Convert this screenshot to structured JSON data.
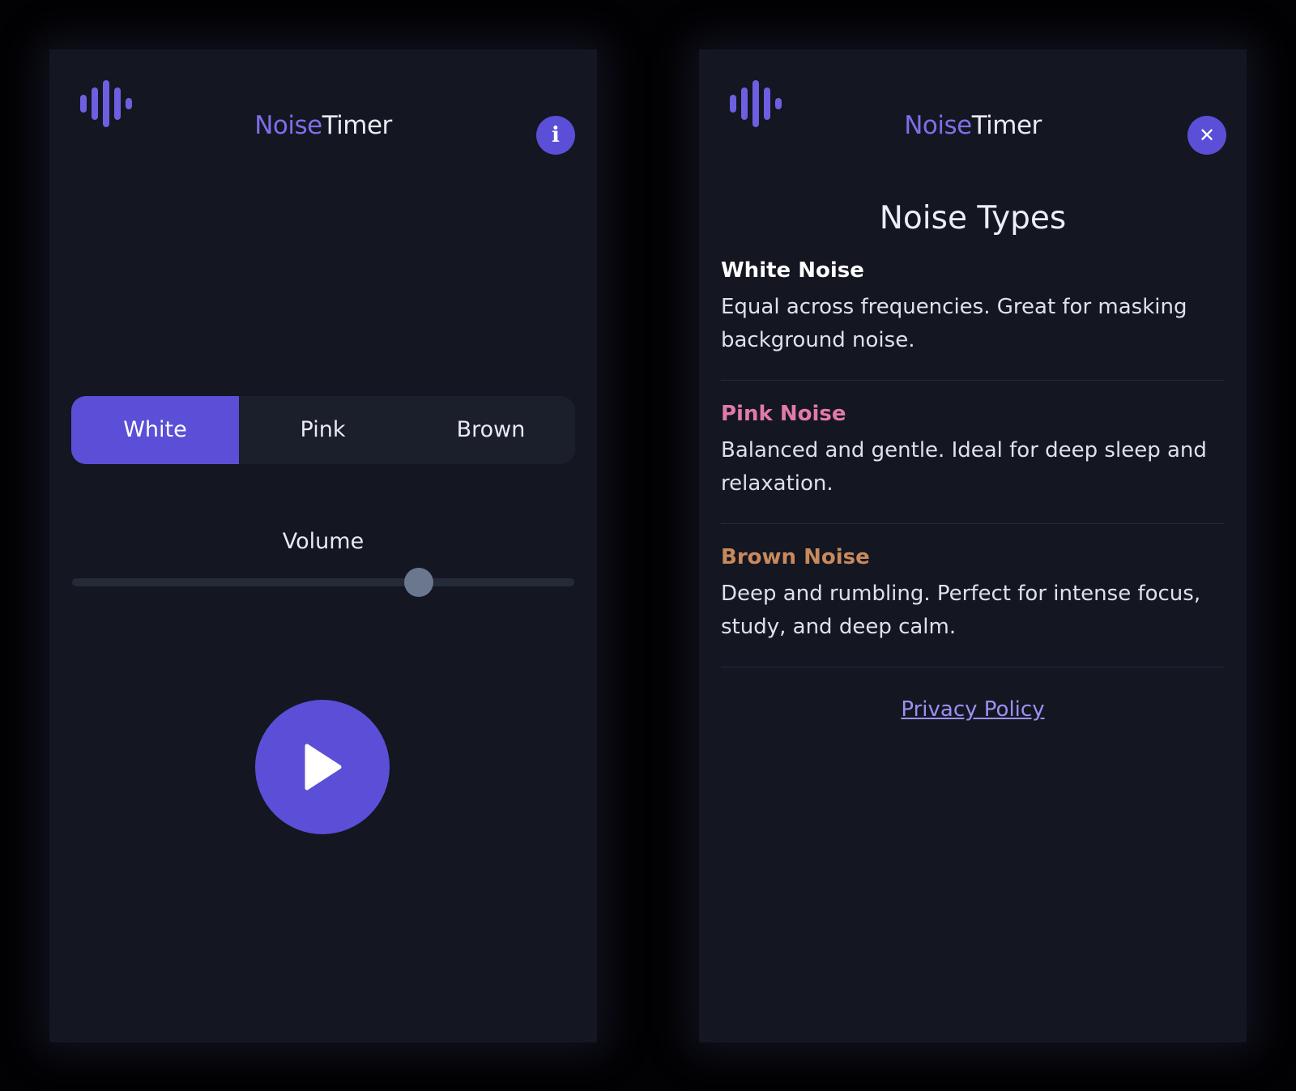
{
  "app": {
    "title_part1": "Noise",
    "title_part2": "Timer"
  },
  "colors": {
    "accent": "#5a4fd6",
    "background": "#141621",
    "white_noise": "#ffffff",
    "pink_noise": "#e27aa8",
    "brown_noise": "#c88a5c"
  },
  "main_screen": {
    "logo_icon": "sound-wave-icon",
    "info_button": {
      "icon": "info-icon",
      "glyph": "i"
    },
    "noise_selector": {
      "options": [
        "White",
        "Pink",
        "Brown"
      ],
      "selected": "White"
    },
    "volume": {
      "label": "Volume",
      "value": 0.69
    },
    "play_button": {
      "icon": "play-icon"
    }
  },
  "info_screen": {
    "logo_icon": "sound-wave-icon",
    "close_button": {
      "icon": "close-icon",
      "glyph": "✕"
    },
    "heading": "Noise Types",
    "types": [
      {
        "name": "White Noise",
        "description": "Equal across frequencies. Great for masking background noise."
      },
      {
        "name": "Pink Noise",
        "description": "Balanced and gentle. Ideal for deep sleep and relaxation."
      },
      {
        "name": "Brown Noise",
        "description": "Deep and rumbling. Perfect for intense focus, study, and deep calm."
      }
    ],
    "privacy_link": "Privacy Policy"
  }
}
